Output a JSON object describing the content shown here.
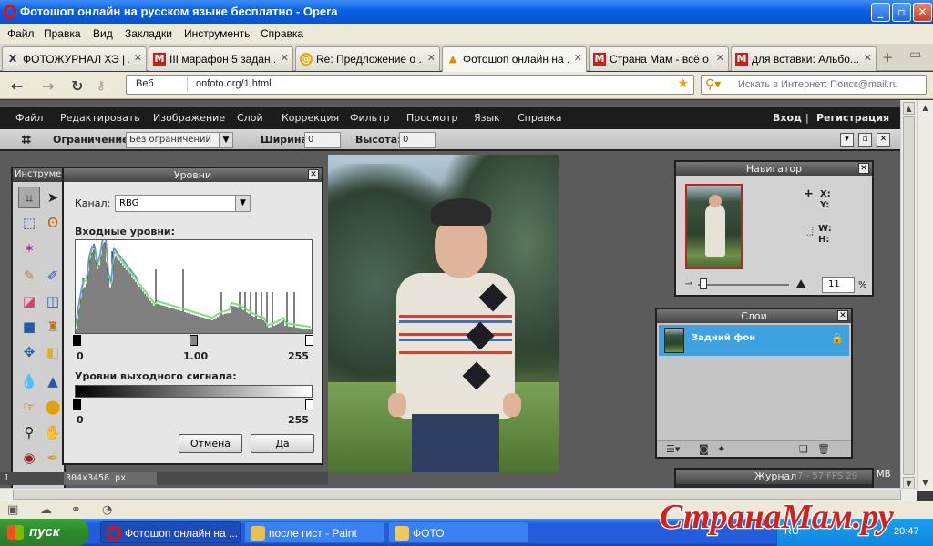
{
  "window": {
    "title": "Фотошоп онлайн на русском языке бесплатно - Opera",
    "controls": [
      "_",
      "▫",
      "✕"
    ]
  },
  "menubar": [
    "Файл",
    "Правка",
    "Вид",
    "Закладки",
    "Инструменты",
    "Справка"
  ],
  "tabs": [
    {
      "label": "ФОТОЖУРНАЛ ХЭ | ...",
      "icon": "X",
      "active": false
    },
    {
      "label": "III марафон 5 задан...",
      "icon": "M",
      "active": false
    },
    {
      "label": "Re: Предложение о ...",
      "icon": "@",
      "active": false
    },
    {
      "label": "Фотошоп онлайн на ...",
      "icon": "▲",
      "active": true
    },
    {
      "label": "Страна Мам - всё о д...",
      "icon": "M",
      "active": false
    },
    {
      "label": "для вставки: Альбо...",
      "icon": "M",
      "active": false
    }
  ],
  "addressbar": {
    "scheme_label": "Веб",
    "url": "onfoto.org/1.html",
    "search_placeholder": "Искать в Интернет: Поиск@mail.ru"
  },
  "app": {
    "menu": [
      "Файл",
      "Редактировать",
      "Изображение",
      "Слой",
      "Коррекция",
      "Фильтр",
      "Просмотр",
      "Язык",
      "Справка"
    ],
    "login": "Вход",
    "divider": "|",
    "register": "Регистрация",
    "options": {
      "constraint_label": "Ограничение:",
      "constraint_value": "Без ограничений",
      "width_label": "Ширина:",
      "width_value": "0",
      "height_label": "Высота:",
      "height_value": "0"
    },
    "tools_title": "Инструменты",
    "levels": {
      "title": "Уровни",
      "channel_label": "Канал:",
      "channel_value": "RBG",
      "input_label": "Входные уровни:",
      "input_values": [
        "0",
        "1.00",
        "255"
      ],
      "output_label": "Уровни выходного сигнала:",
      "output_values": [
        "0",
        "255"
      ],
      "cancel": "Отмена",
      "ok": "Да"
    },
    "status": {
      "zoom": "1",
      "size": "304x3456 px"
    },
    "navigator": {
      "title": "Навигатор",
      "x_label": "X:",
      "y_label": "Y:",
      "w_label": "W:",
      "h_label": "H:",
      "zoom": "11",
      "zoom_unit": "%"
    },
    "layers": {
      "title": "Слои",
      "layer_name": "Задний фон"
    },
    "journal": {
      "title": "Журнал",
      "fps": "7 - 57 FPS 29",
      "mem": "MB"
    }
  },
  "taskbar": {
    "start": "пуск",
    "tasks": [
      {
        "label": "Фотошоп онлайн на ...",
        "active": true
      },
      {
        "label": "после гист - Paint",
        "active": false
      },
      {
        "label": "ФОТО",
        "active": false
      }
    ],
    "lang": "RU",
    "clock": "20:47"
  },
  "watermark": "СтранаМам.ру"
}
